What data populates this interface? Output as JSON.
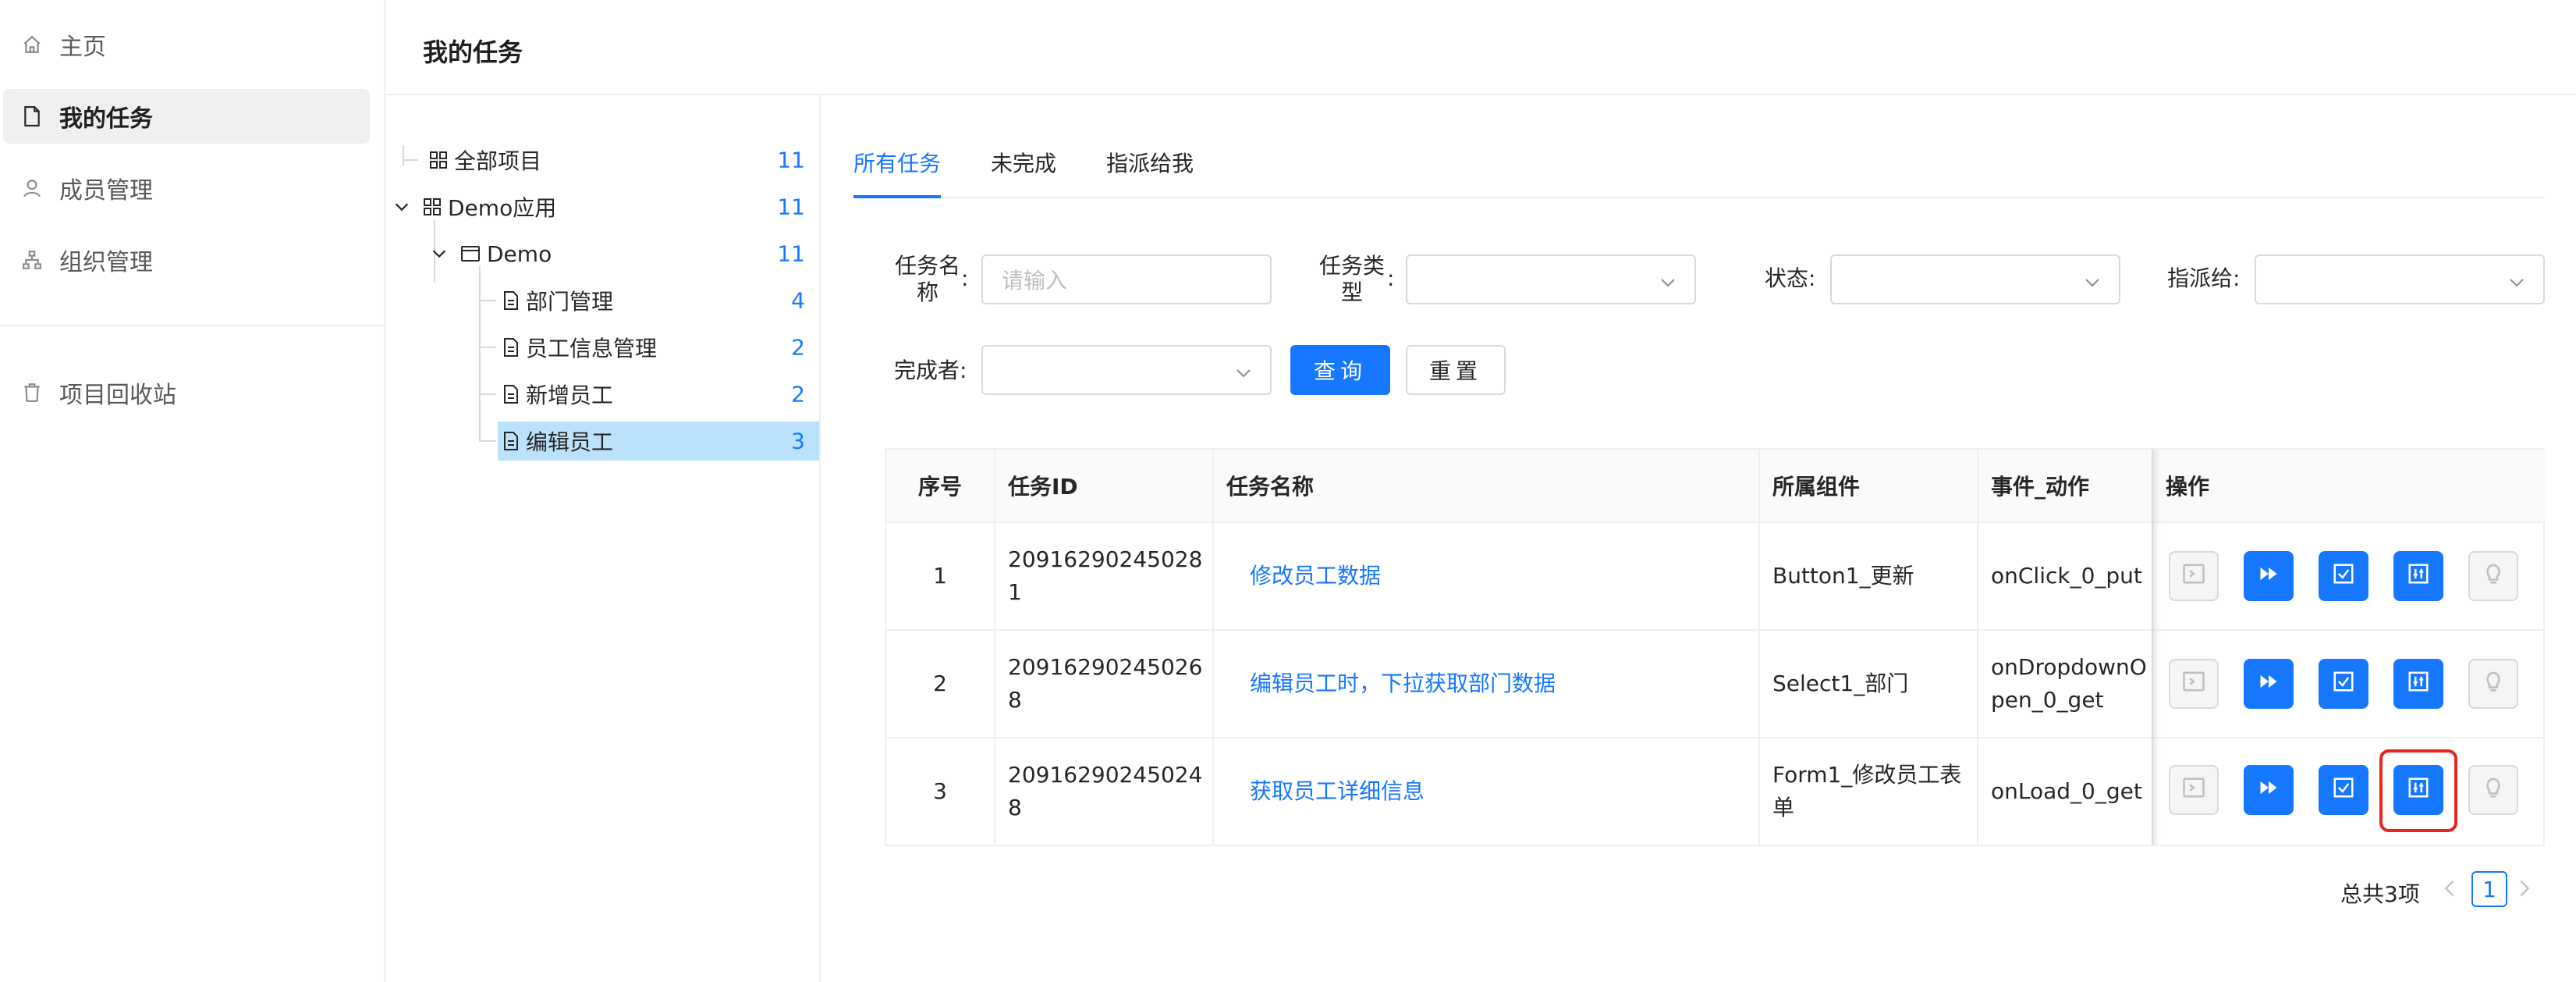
{
  "nav": {
    "items": [
      {
        "label": "主页",
        "icon": "home-icon"
      },
      {
        "label": "我的任务",
        "icon": "file-icon"
      },
      {
        "label": "成员管理",
        "icon": "user-icon"
      },
      {
        "label": "组织管理",
        "icon": "org-icon"
      },
      {
        "label": "项目回收站",
        "icon": "trash-icon"
      }
    ]
  },
  "header": {
    "title": "我的任务"
  },
  "tree": {
    "nodes": [
      {
        "label": "全部项目",
        "count": "11"
      },
      {
        "label": "Demo应用",
        "count": "11"
      },
      {
        "label": "Demo",
        "count": "11"
      },
      {
        "label": "部门管理",
        "count": "4"
      },
      {
        "label": "员工信息管理",
        "count": "2"
      },
      {
        "label": "新增员工",
        "count": "2"
      },
      {
        "label": "编辑员工",
        "count": "3"
      }
    ]
  },
  "tabs": [
    {
      "label": "所有任务"
    },
    {
      "label": "未完成"
    },
    {
      "label": "指派给我"
    }
  ],
  "filters": {
    "task_name_label": "任务名称",
    "task_name_placeholder": "请输入",
    "task_type_label": "任务类型",
    "status_label": "状态",
    "assignee_label": "指派给",
    "completer_label": "完成者",
    "colon": ":",
    "query_label": "查询",
    "reset_label": "重置"
  },
  "table": {
    "headers": [
      "序号",
      "任务ID",
      "任务名称",
      "所属组件",
      "事件_动作",
      "操作"
    ],
    "rows": [
      {
        "index": "1",
        "id": "209162902450281",
        "name": "修改员工数据",
        "component": "Button1_更新",
        "event": "onClick_0_put"
      },
      {
        "index": "2",
        "id": "209162902450268",
        "name": "编辑员工时，下拉获取部门数据",
        "component": "Select1_部门",
        "event": "onDropdownOpen_0_get"
      },
      {
        "index": "3",
        "id": "209162902450248",
        "name": "获取员工详细信息",
        "component": "Form1_修改员工表单",
        "event": "onLoad_0_get"
      }
    ]
  },
  "pagination": {
    "total": "总共3项",
    "current_page": "1"
  },
  "colors": {
    "primary": "#1677ff",
    "highlight": "#e8241f",
    "selected": "#bae3fb"
  }
}
